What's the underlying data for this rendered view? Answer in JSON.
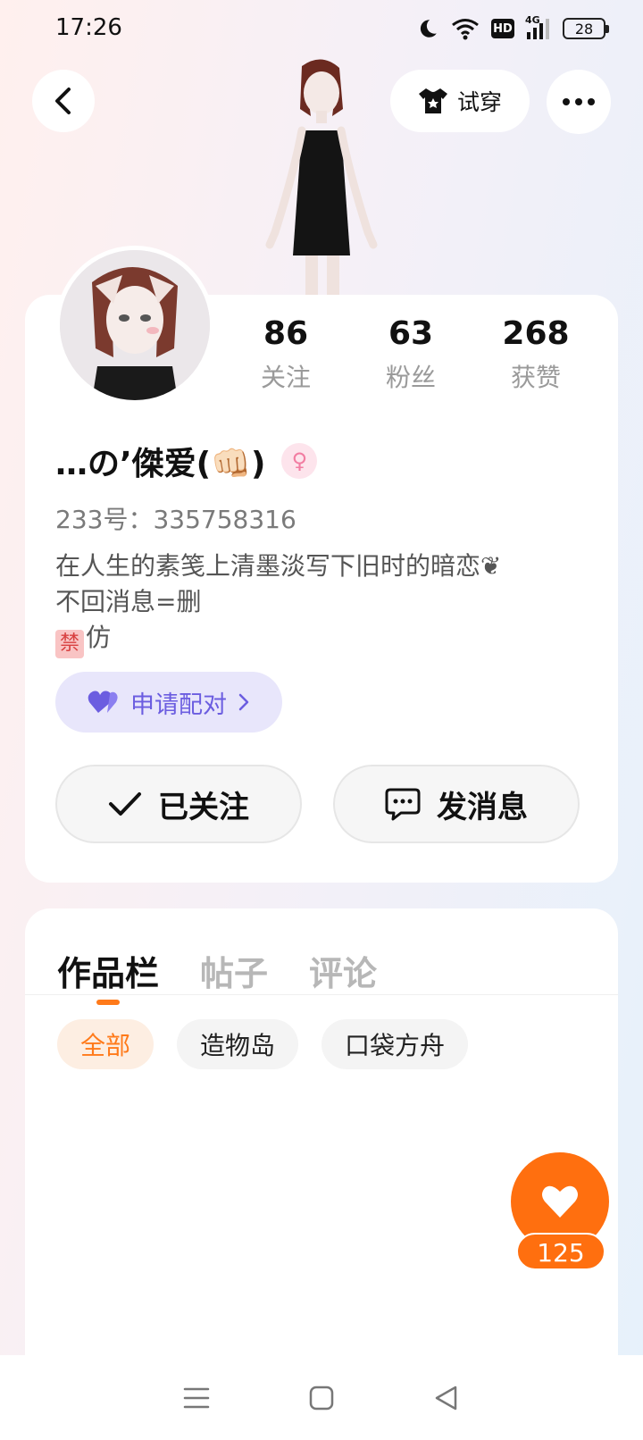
{
  "status_bar": {
    "time": "17:26",
    "hd_label": "HD",
    "network_label": "4G",
    "battery": "28"
  },
  "header": {
    "try_on_label": "试穿"
  },
  "stats": [
    {
      "value": "86",
      "label": "关注"
    },
    {
      "value": "63",
      "label": "粉丝"
    },
    {
      "value": "268",
      "label": "获赞"
    }
  ],
  "profile": {
    "username": "…の’傑爱(👊🏻)",
    "gender_symbol": "♀",
    "uid": "233号：335758316",
    "bio": [
      "在人生的素笺上清墨淡写下旧时的暗恋❦",
      "不回消息=删",
      "仿"
    ],
    "ban_glyph": "禁",
    "pair_label": "申请配对",
    "follow_label": "已关注",
    "message_label": "发消息"
  },
  "tabs": [
    {
      "label": "作品栏",
      "active": true
    },
    {
      "label": "帖子",
      "active": false
    },
    {
      "label": "评论",
      "active": false
    }
  ],
  "chips": [
    {
      "label": "全部",
      "active": true
    },
    {
      "label": "造物岛",
      "active": false
    },
    {
      "label": "口袋方舟",
      "active": false
    }
  ],
  "like": {
    "count": "125"
  },
  "colors": {
    "accent": "#ff7a1a",
    "pair": "#6b5de0",
    "gender": "#f27da2"
  },
  "icons": {
    "back": "chevron-left-icon",
    "try_on": "shirt-icon",
    "more": "more-icon",
    "pair": "heart-icon",
    "follow": "check-icon",
    "message": "chat-icon",
    "like": "heart-icon",
    "nav": [
      "menu-icon",
      "home-icon",
      "back-icon"
    ]
  }
}
